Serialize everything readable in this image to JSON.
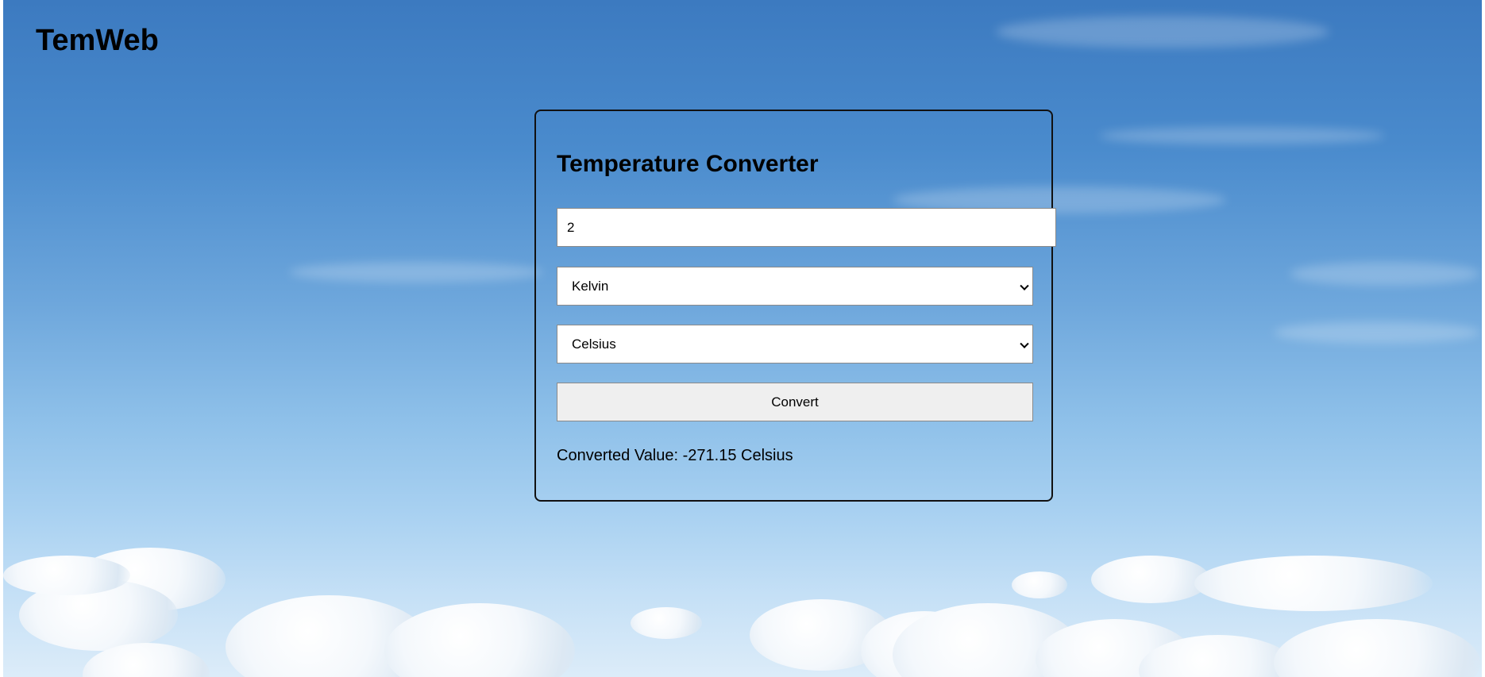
{
  "app": {
    "brand": "TemWeb"
  },
  "converter": {
    "title": "Temperature Converter",
    "input_value": "2",
    "from_unit": "Kelvin",
    "to_unit": "Celsius",
    "convert_label": "Convert",
    "result_text": "Converted Value: -271.15 Celsius"
  },
  "icons": {
    "dropdown": "chevron-down-icon"
  },
  "colors": {
    "sky_top": "#3c7ac0",
    "sky_bottom": "#dcecf9",
    "button_bg": "#efefef",
    "card_border": "#111111"
  }
}
